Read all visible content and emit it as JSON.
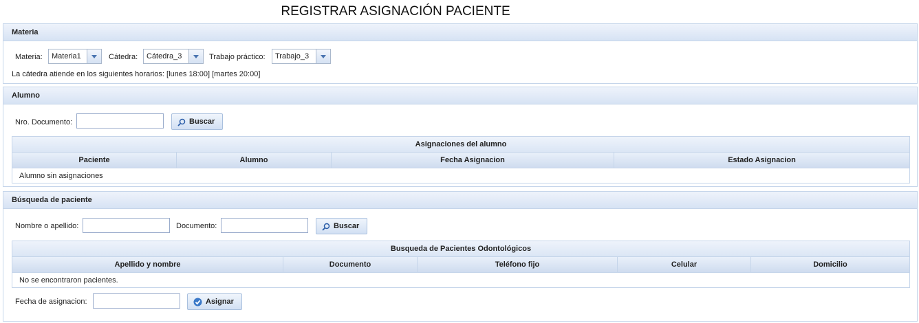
{
  "page": {
    "title": "REGISTRAR ASIGNACIÓN PACIENTE"
  },
  "materia_panel": {
    "header": "Materia",
    "materia_label": "Materia:",
    "materia_value": "Materia1",
    "catedra_label": "Cátedra:",
    "catedra_value": "Cátedra_3",
    "trabajo_label": "Trabajo práctico:",
    "trabajo_value": "Trabajo_3",
    "horarios": "La cátedra atiende en los siguientes horarios: [lunes 18:00] [martes 20:00]"
  },
  "alumno_panel": {
    "header": "Alumno",
    "doc_label": "Nro. Documento:",
    "doc_value": "",
    "search_label": "Buscar",
    "grid_title": "Asignaciones del alumno",
    "columns": [
      "Paciente",
      "Alumno",
      "Fecha Asignacion",
      "Estado Asignacion"
    ],
    "empty_text": "Alumno sin asignaciones"
  },
  "paciente_panel": {
    "header": "Búsqueda de paciente",
    "name_label": "Nombre o apellido:",
    "name_value": "",
    "doc_label": "Documento:",
    "doc_value": "",
    "search_label": "Buscar",
    "grid_title": "Busqueda de Pacientes Odontológicos",
    "columns": [
      "Apellido y nombre",
      "Documento",
      "Teléfono fijo",
      "Celular",
      "Domicilio"
    ],
    "empty_text": "No se encontraron pacientes.",
    "fecha_label": "Fecha de asignacion:",
    "fecha_value": "",
    "assign_label": "Asignar"
  }
}
